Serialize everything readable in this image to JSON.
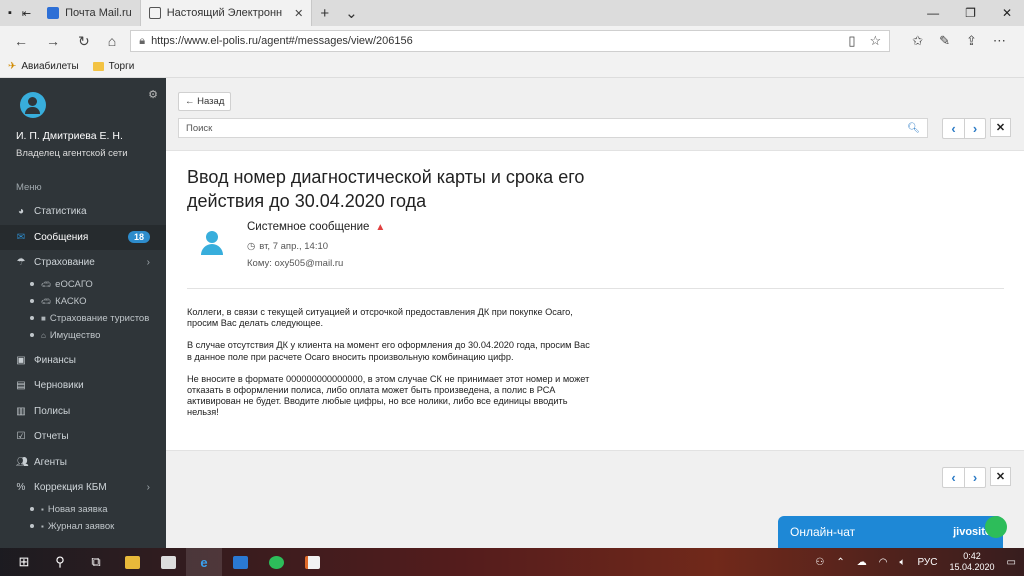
{
  "browser": {
    "tabs": [
      {
        "label": "Почта Mail.ru"
      },
      {
        "label": "Настоящий Электронн"
      }
    ],
    "url": "https://www.el-polis.ru/agent#/messages/view/206156",
    "bookmarks": [
      "Авиабилеты",
      "Торги"
    ]
  },
  "sidebar": {
    "user_name": "И. П. Дмитриева Е. Н.",
    "user_role": "Владелец агентской сети",
    "menu_heading": "Меню",
    "items": [
      {
        "label": "Статистика",
        "icon": "pie-chart-icon"
      },
      {
        "label": "Сообщения",
        "icon": "envelope-icon",
        "badge": "18"
      },
      {
        "label": "Страхование",
        "icon": "umbrella-icon"
      },
      {
        "label": "Финансы",
        "icon": "money-icon"
      },
      {
        "label": "Черновики",
        "icon": "file-icon"
      },
      {
        "label": "Полисы",
        "icon": "document-icon"
      },
      {
        "label": "Отчеты",
        "icon": "checkbox-icon"
      },
      {
        "label": "Агенты",
        "icon": "users-icon"
      },
      {
        "label": "Коррекция КБМ",
        "icon": "percent-icon"
      }
    ],
    "insurance_sub": [
      {
        "label": "еОСАГО"
      },
      {
        "label": "КАСКО"
      },
      {
        "label": "Страхование туристов"
      },
      {
        "label": "Имущество"
      }
    ],
    "kbm_sub": [
      {
        "label": "Новая заявка"
      },
      {
        "label": "Журнал заявок"
      }
    ]
  },
  "toolbar": {
    "back_label": "← Назад",
    "search_placeholder": "Поиск"
  },
  "message": {
    "title": "Ввод номер диагностической карты и срока его действия до 30.04.2020 года",
    "sender": "Системное сообщение",
    "date": "вт, 7 апр., 14:10",
    "to": "Кому: oxy505@mail.ru",
    "paragraphs": [
      "Коллеги, в связи с текущей ситуацией и отсрочкой предоставления ДК при покупке Осаго, просим Вас делать следующее.",
      "В случае отсутствия ДК у клиента на момент его оформления до 30.04.2020 года, просим Вас в данное поле при расчете Осаго вносить произвольную комбинацию цифр.",
      "Не вносите в формате 000000000000000, в этом случае СК не принимает этот номер и может отказать в оформлении полиса, либо оплата может быть произведена, а полис в РСА активирован не будет. Вводите любые цифры, но все нолики, либо все единицы вводить нельзя!"
    ]
  },
  "chat": {
    "label": "Онлайн-чат",
    "brand": "jivosite"
  },
  "taskbar": {
    "lang": "РУС",
    "time": "0:42",
    "date": "15.04.2020"
  },
  "colors": {
    "sidebar_bg": "#2f3539",
    "accent": "#2d7cc6",
    "badge": "#2d8ccc",
    "chat": "#1e88d6"
  }
}
